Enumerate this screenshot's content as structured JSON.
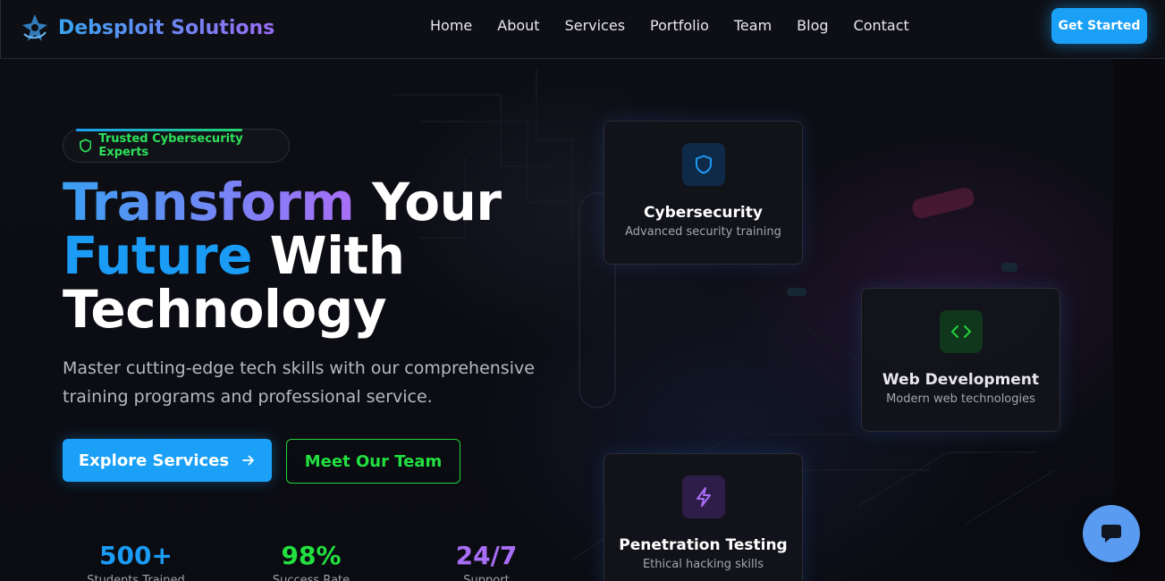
{
  "header": {
    "brand": "Debsploit Solutions",
    "nav": [
      "Home",
      "About",
      "Services",
      "Portfolio",
      "Team",
      "Blog",
      "Contact"
    ],
    "cta": "Get Started"
  },
  "hero": {
    "badge": "Trusted Cybersecurity Experts",
    "headline": {
      "w1": "Transform",
      "w2": " Your",
      "w3": "Future",
      "w4": " With",
      "w5": "Technology"
    },
    "subtitle": "Master cutting-edge tech skills with our comprehensive training programs and professional service.",
    "primary_button": "Explore Services",
    "secondary_button": "Meet Our Team",
    "stats": [
      {
        "value": "500+",
        "label": "Students Trained",
        "color": "#1a9cf6"
      },
      {
        "value": "98%",
        "label": "Success Rate",
        "color": "#22e040"
      },
      {
        "value": "24/7",
        "label": "Support",
        "color": "#a86ef7"
      }
    ]
  },
  "cards": [
    {
      "title": "Cybersecurity",
      "subtitle": "Advanced security training",
      "icon": "shield-icon",
      "color": "#1a9cf6"
    },
    {
      "title": "Web Development",
      "subtitle": "Modern web technologies",
      "icon": "code-icon",
      "color": "#22d43c"
    },
    {
      "title": "Penetration Testing",
      "subtitle": "Ethical hacking skills",
      "icon": "lightning-icon",
      "color": "#a86ef7"
    }
  ],
  "colors": {
    "accent_blue": "#1aa0f7",
    "accent_green": "#22e040",
    "accent_purple": "#a86ef7",
    "background": "#0b0c12"
  }
}
